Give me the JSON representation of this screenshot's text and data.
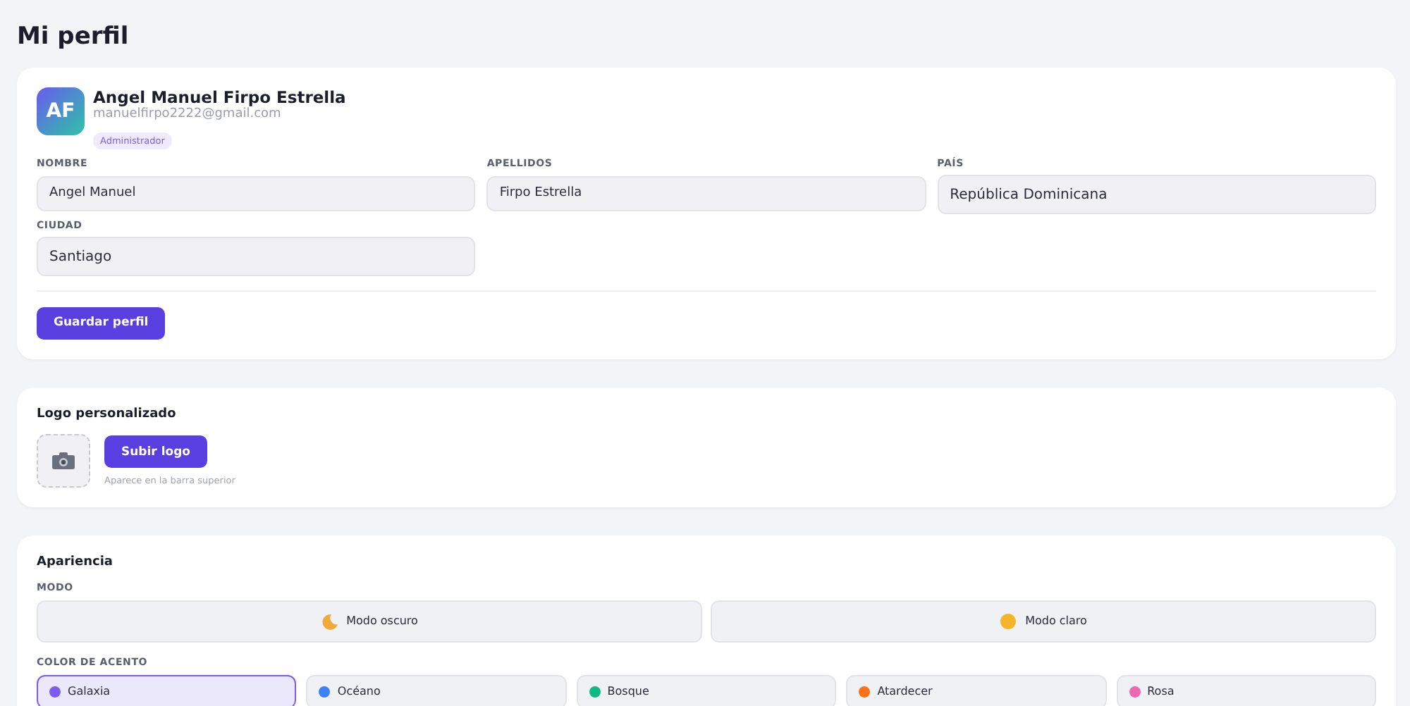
{
  "page_title": "Mi perfil",
  "profile": {
    "initials": "AF",
    "name": "Angel Manuel Firpo Estrella",
    "email": "manuelfirpo2222@gmail.com",
    "role": "Administrador",
    "fields": [
      {
        "label": "NOMBRE",
        "value": "Angel Manuel"
      },
      {
        "label": "APELLIDOS",
        "value": "Firpo Estrella"
      },
      {
        "label": "PAÍS",
        "value": "República Dominicana"
      },
      {
        "label": "CIUDAD",
        "value": "Santiago"
      }
    ],
    "save_button": "Guardar perfil"
  },
  "logo": {
    "title": "Logo personalizado",
    "upload_button": "Subir logo",
    "hint": "Aparece en la barra superior"
  },
  "appearance": {
    "title": "Apariencia",
    "mode_label": "MODO",
    "modes": [
      {
        "kind": "moon",
        "label": "Modo oscuro",
        "selected": false
      },
      {
        "kind": "sun",
        "label": "Modo claro",
        "selected": false
      }
    ],
    "accent_label": "COLOR DE ACENTO",
    "accents": [
      {
        "label": "Galaxia",
        "color": "#7c5cf0",
        "selected": true
      },
      {
        "label": "Océano",
        "color": "#3b82f6",
        "selected": false
      },
      {
        "label": "Bosque",
        "color": "#10b981",
        "selected": false
      },
      {
        "label": "Atardecer",
        "color": "#f97316",
        "selected": false
      },
      {
        "label": "Rosa",
        "color": "#ec69b0",
        "selected": false
      }
    ]
  }
}
